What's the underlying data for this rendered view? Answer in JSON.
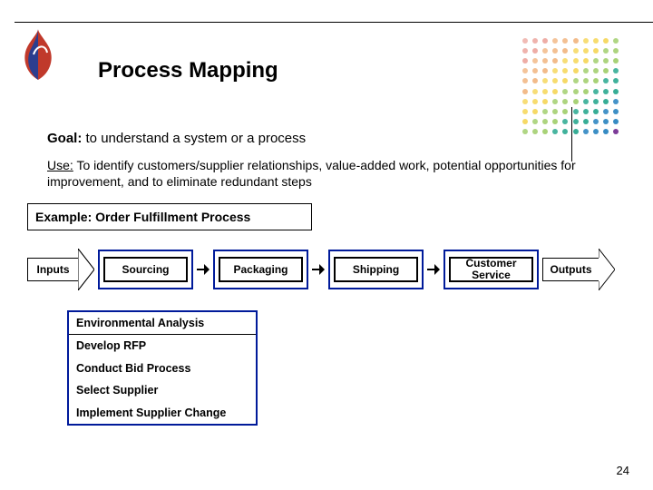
{
  "title": "Process Mapping",
  "goal": {
    "label": "Goal:",
    "text": "to understand a system or a process"
  },
  "use": {
    "label": "Use:",
    "text": "To identify customers/supplier relationships, value-added work, potential opportunities for improvement,  and to eliminate redundant steps"
  },
  "example_label": "Example: Order Fulfillment Process",
  "flow": {
    "inputs": "Inputs",
    "steps": [
      "Sourcing",
      "Packaging",
      "Shipping",
      "Customer Service"
    ],
    "outputs": "Outputs"
  },
  "sub_steps": [
    "Environmental Analysis",
    "Develop RFP",
    "Conduct Bid Process",
    "Select Supplier",
    "Implement Supplier Change"
  ],
  "page_number": "24",
  "dot_colors": [
    "#d73c2c",
    "#e67e22",
    "#f1c40f",
    "#8bc34a",
    "#16a085",
    "#2e86c1",
    "#7d3c98"
  ]
}
